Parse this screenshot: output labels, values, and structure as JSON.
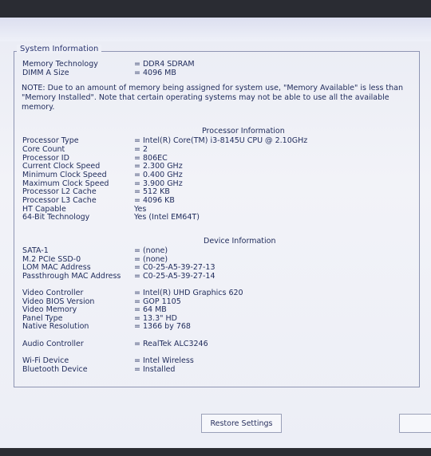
{
  "panel": {
    "legend": "System Information"
  },
  "memory": [
    {
      "label": "Memory Technology",
      "value": "= DDR4 SDRAM"
    },
    {
      "label": "DIMM A Size",
      "value": "= 4096 MB"
    }
  ],
  "note": "NOTE: Due to an amount of memory being assigned for system use, \"Memory Available\" is less than \"Memory Installed\". Note that certain operating systems may not be able to use all the available memory.",
  "processor": {
    "title": "Processor Information",
    "rows": [
      {
        "label": "Processor Type",
        "value": "= Intel(R) Core(TM) i3-8145U CPU @ 2.10GHz"
      },
      {
        "label": "Core Count",
        "value": "= 2"
      },
      {
        "label": "Processor ID",
        "value": "= 806EC"
      },
      {
        "label": "Current Clock Speed",
        "value": "= 2.300 GHz"
      },
      {
        "label": "Minimum Clock Speed",
        "value": "= 0.400 GHz"
      },
      {
        "label": "Maximum Clock Speed",
        "value": "= 3.900 GHz"
      },
      {
        "label": "Processor L2 Cache",
        "value": "= 512 KB"
      },
      {
        "label": "Processor L3 Cache",
        "value": "= 4096 KB"
      },
      {
        "label": "HT Capable",
        "value": "Yes"
      },
      {
        "label": "64-Bit Technology",
        "value": "Yes (Intel EM64T)"
      }
    ]
  },
  "device": {
    "title": "Device Information",
    "rows": [
      {
        "label": "SATA-1",
        "value": "= (none)"
      },
      {
        "label": "M.2 PCIe SSD-0",
        "value": "= (none)"
      },
      {
        "label": "LOM MAC Address",
        "value": "= C0-25-A5-39-27-13"
      },
      {
        "label": "Passthrough MAC Address",
        "value": "= C0-25-A5-39-27-14"
      },
      {
        "label": "Video Controller",
        "value": "= Intel(R) UHD Graphics 620"
      },
      {
        "label": "Video BIOS Version",
        "value": "= GOP 1105"
      },
      {
        "label": "Video Memory",
        "value": "= 64 MB"
      },
      {
        "label": "Panel Type",
        "value": "= 13.3\" HD"
      },
      {
        "label": "Native Resolution",
        "value": "= 1366 by 768"
      },
      {
        "label": "Audio Controller",
        "value": "= RealTek ALC3246"
      },
      {
        "label": "Wi-Fi Device",
        "value": "= Intel Wireless"
      },
      {
        "label": "Bluetooth Device",
        "value": "= Installed"
      }
    ]
  },
  "buttons": {
    "restore": "Restore Settings"
  }
}
